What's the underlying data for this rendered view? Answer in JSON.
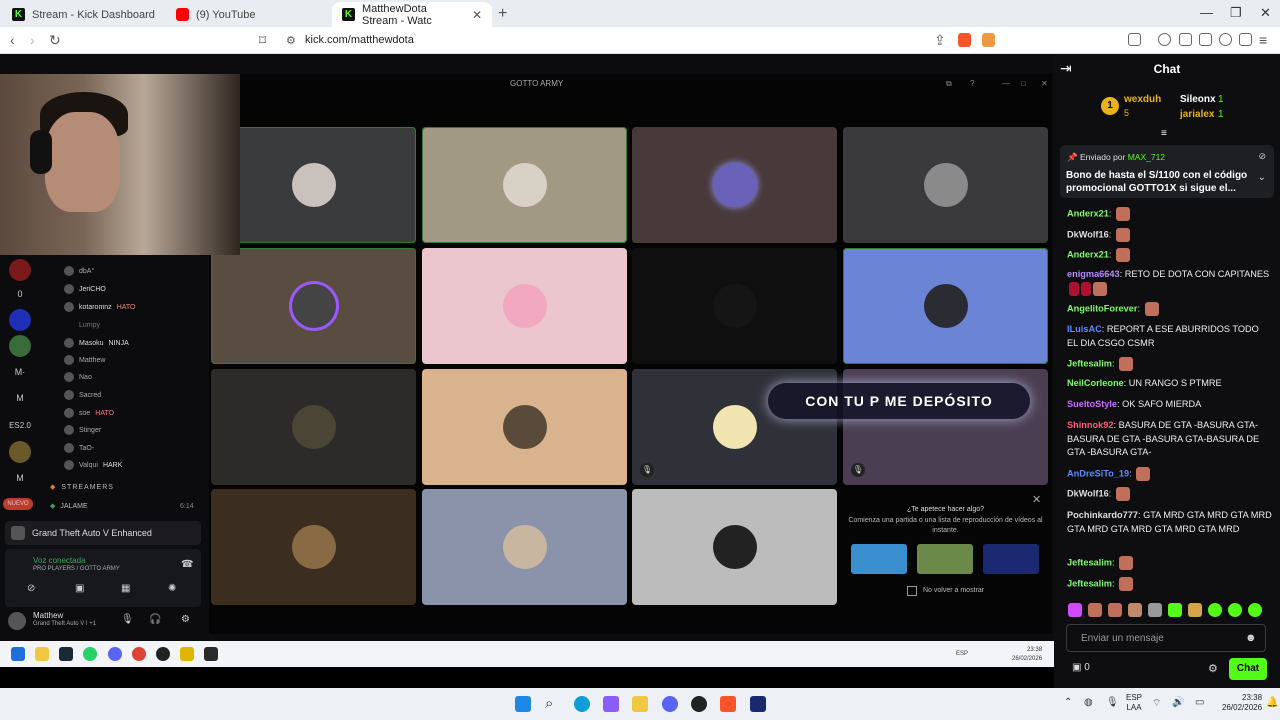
{
  "browser": {
    "tabs": [
      {
        "label": "Stream - Kick Dashboard"
      },
      {
        "label": "(9) YouTube"
      },
      {
        "label": "MatthewDota Stream - Watc"
      }
    ],
    "url": "kick.com/matthewdota"
  },
  "discord": {
    "window_title": "GOTTO ARMY",
    "overlay_banner": "CON TU P  ME  DEPÓSITO",
    "promo": {
      "title": "¿Te apetece hacer algo?",
      "body": "Comienza una partida o una lista de reproducción de vídeos al instante.",
      "dont_show": "No volver a mostrar"
    },
    "servers": [
      "0",
      "M·",
      "M",
      "ES2.0",
      "M",
      "NUEVO"
    ],
    "members": [
      "dbA°",
      "JeriCHO",
      "kotaromnz",
      "Lumpy",
      "Masoku",
      "Matthew",
      "Nao",
      "Sacred",
      "soe",
      "Stinger",
      "TaO-",
      "Valqui"
    ],
    "member_tags": {
      "kotaromnz": "HATO",
      "Masoku": "NINJA",
      "soe": "HATO",
      "Valqui": "HARK"
    },
    "channel_streamers": "STREAMERS",
    "channel_jalame": "JALAME",
    "channel_time": "6:14",
    "game": "Grand Theft Auto V Enhanced",
    "voice": {
      "status": "Voz conectada",
      "server": "PRO PLAYERS / GOTTO ARMY"
    },
    "user": {
      "name": "Matthew",
      "status": "Grand Theft Auto V I +1"
    },
    "inner_clock": {
      "time": "23:38",
      "date": "26/02/2026",
      "lang": "ESP"
    }
  },
  "chat": {
    "title": "Chat",
    "gifters": [
      {
        "name": "wexduh",
        "count": "5",
        "rank": "1"
      },
      {
        "name": "Sileonx",
        "count": "1"
      },
      {
        "name": "jarialex",
        "count": "1"
      }
    ],
    "pinned": {
      "prefix": "Enviado por",
      "user": "MAX_712",
      "message": "Bono de hasta el S/1100 con el código promocional GOTTO1X si sigue el..."
    },
    "messages": [
      {
        "user": "Anderx21",
        "text": "",
        "color": "#7dfc68"
      },
      {
        "user": "DkWolf16",
        "text": "",
        "color": "#dddddd"
      },
      {
        "user": "Anderx21",
        "text": "",
        "color": "#7dfc68"
      },
      {
        "user": "enigma6643",
        "text": "RETO DE DOTA CON CAPITANES",
        "color": "#b58cff"
      },
      {
        "user": "AngelitoForever",
        "text": "",
        "color": "#7dfc68"
      },
      {
        "user": "ILuisAC",
        "text": "REPORT A ESE ABURRIDOS TODO EL DIA CSGO CSMR",
        "color": "#5a8dff"
      },
      {
        "user": "Jeftesalim",
        "text": "",
        "color": "#7dfc68"
      },
      {
        "user": "NeilCorleone",
        "text": "UN RANGO S PTMRE",
        "color": "#7dfc68"
      },
      {
        "user": "SueltoStyle",
        "text": "OK SAFO MIERDA",
        "color": "#d06bff"
      },
      {
        "user": "Shinnok92",
        "text": "BASURA DE GTA -BASURA GTA-BASURA DE GTA -BASURA GTA-BASURA DE GTA -BASURA GTA-",
        "color": "#ff5a7a"
      },
      {
        "user": "AnDreSiTo_19",
        "text": "",
        "color": "#5a8dff"
      },
      {
        "user": "DkWolf16",
        "text": "",
        "color": "#dddddd"
      },
      {
        "user": "Pochinkardo777",
        "text": "GTA MRD  GTA MRD  GTA MRD  GTA MRD  GTA MRD  GTA MRD  GTA MRD",
        "color": "#dddddd"
      },
      {
        "user": "Jeftesalim",
        "text": "",
        "color": "#7dfc68"
      },
      {
        "user": "Jeftesalim",
        "text": "",
        "color": "#7dfc68"
      }
    ],
    "input_placeholder": "Enviar un mensaje",
    "points": "0",
    "send_label": "Chat"
  },
  "os": {
    "time": "23:38",
    "date": "26/02/2026",
    "lang": "ESP",
    "lang2": "LAA"
  },
  "colors": {
    "kick_green": "#53fc18",
    "speaking": "#2e7d32"
  }
}
